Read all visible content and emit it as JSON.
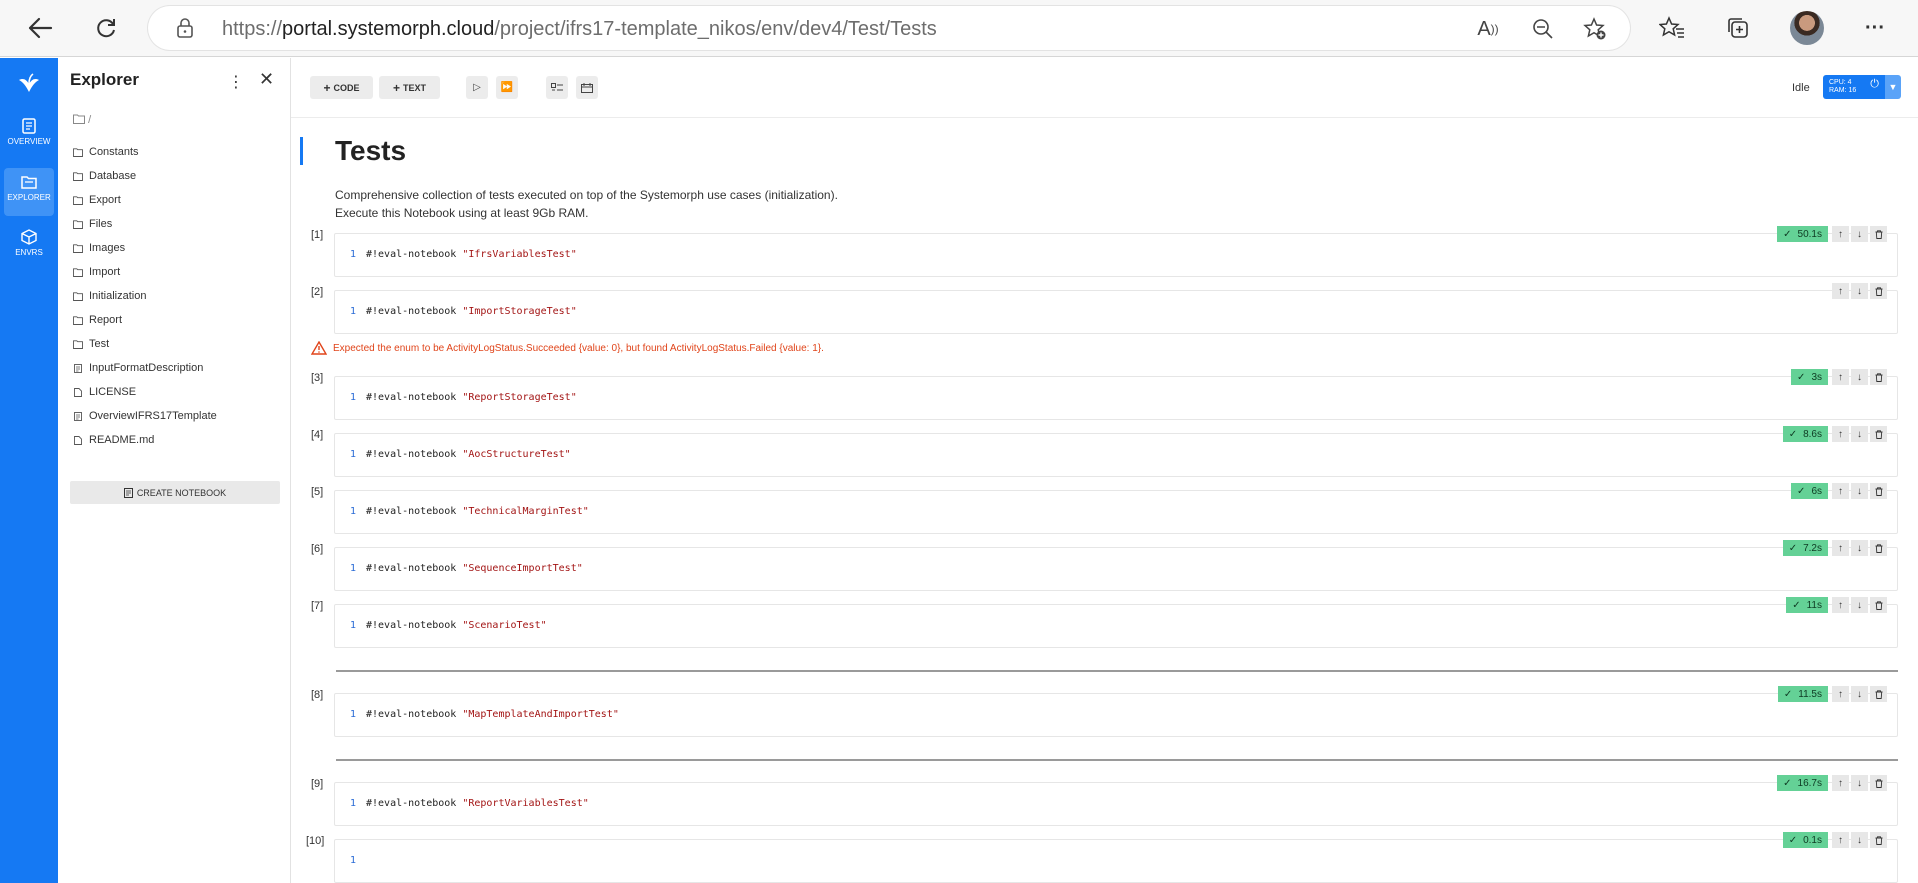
{
  "browser": {
    "url_prefix": "https://",
    "url_host": "portal.systemorph.cloud",
    "url_path": "/project/ifrs17-template_nikos/env/dev4/Test/Tests"
  },
  "rail": {
    "items": [
      {
        "label": "OVERVIEW",
        "icon": "notebook-icon"
      },
      {
        "label": "EXPLORER",
        "icon": "folder-icon"
      },
      {
        "label": "ENVRS",
        "icon": "cube-icon"
      }
    ]
  },
  "explorer": {
    "title": "Explorer",
    "root": "/",
    "items": [
      {
        "name": "Constants",
        "type": "folder"
      },
      {
        "name": "Database",
        "type": "folder"
      },
      {
        "name": "Export",
        "type": "folder"
      },
      {
        "name": "Files",
        "type": "folder"
      },
      {
        "name": "Images",
        "type": "folder"
      },
      {
        "name": "Import",
        "type": "folder"
      },
      {
        "name": "Initialization",
        "type": "folder"
      },
      {
        "name": "Report",
        "type": "folder"
      },
      {
        "name": "Test",
        "type": "folder"
      },
      {
        "name": "InputFormatDescription",
        "type": "notebook"
      },
      {
        "name": "LICENSE",
        "type": "file"
      },
      {
        "name": "OverviewIFRS17Template",
        "type": "notebook"
      },
      {
        "name": "README.md",
        "type": "file"
      }
    ],
    "create_label": "CREATE NOTEBOOK"
  },
  "toolbar": {
    "code_label": "CODE",
    "text_label": "TEXT",
    "status": "Idle",
    "cpu": "CPU: 4",
    "ram": "RAM: 16"
  },
  "notebook": {
    "title": "Tests",
    "desc1": "Comprehensive collection of tests executed on top of the Systemorph use cases (initialization).",
    "desc2": "Execute this Notebook using at least 9Gb RAM.",
    "error": "Expected the enum to be ActivityLogStatus.Succeeded {value: 0}, but found ActivityLogStatus.Failed {value: 1}.",
    "cells": [
      {
        "num": "[1]",
        "line": "1",
        "cmd": "#!eval-notebook ",
        "arg": "\"IfrsVariablesTest\"",
        "time": "50.1s"
      },
      {
        "num": "[2]",
        "line": "1",
        "cmd": "#!eval-notebook ",
        "arg": "\"ImportStorageTest\"",
        "time": ""
      },
      {
        "num": "[3]",
        "line": "1",
        "cmd": "#!eval-notebook ",
        "arg": "\"ReportStorageTest\"",
        "time": "3s"
      },
      {
        "num": "[4]",
        "line": "1",
        "cmd": "#!eval-notebook ",
        "arg": "\"AocStructureTest\"",
        "time": "8.6s"
      },
      {
        "num": "[5]",
        "line": "1",
        "cmd": "#!eval-notebook ",
        "arg": "\"TechnicalMarginTest\"",
        "time": "6s"
      },
      {
        "num": "[6]",
        "line": "1",
        "cmd": "#!eval-notebook ",
        "arg": "\"SequenceImportTest\"",
        "time": "7.2s"
      },
      {
        "num": "[7]",
        "line": "1",
        "cmd": "#!eval-notebook ",
        "arg": "\"ScenarioTest\"",
        "time": "11s"
      },
      {
        "num": "[8]",
        "line": "1",
        "cmd": "#!eval-notebook ",
        "arg": "\"MapTemplateAndImportTest\"",
        "time": "11.5s"
      },
      {
        "num": "[9]",
        "line": "1",
        "cmd": "#!eval-notebook ",
        "arg": "\"ReportVariablesTest\"",
        "time": "16.7s"
      },
      {
        "num": "[10]",
        "line": "1",
        "cmd": "",
        "arg": "",
        "time": "0.1s"
      }
    ]
  },
  "colors": {
    "accent": "#1579f3",
    "success": "#64d196",
    "error": "#e0441a"
  }
}
